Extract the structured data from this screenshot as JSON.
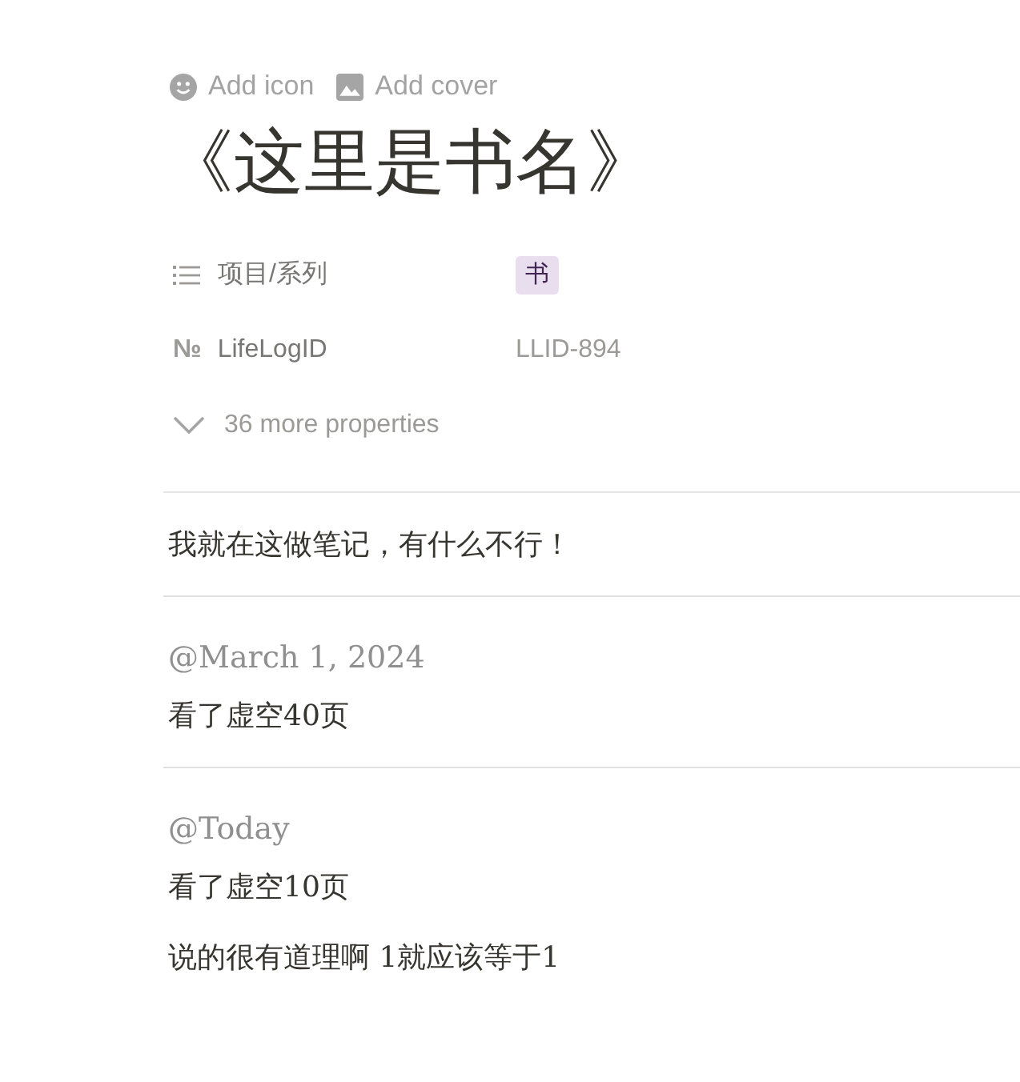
{
  "header_actions": [
    {
      "kind": "icon",
      "label": "Add icon"
    },
    {
      "kind": "cover",
      "label": "Add cover"
    }
  ],
  "title": "《这里是书名》",
  "properties": [
    {
      "kind": "list",
      "name": "项目/系列",
      "tag": "书"
    },
    {
      "kind": "number",
      "icon": "№",
      "name": "LifeLogID",
      "value": "LLID-894"
    }
  ],
  "more_properties": "36 more properties",
  "blocks": [
    {
      "kind": "text",
      "text": "我就在这做笔记，有什么不行！"
    },
    {
      "kind": "divider"
    },
    {
      "kind": "mention",
      "text": "@March 1, 2024"
    },
    {
      "kind": "text",
      "text": "看了虚空40页"
    },
    {
      "kind": "divider"
    },
    {
      "kind": "mention",
      "text": "@Today"
    },
    {
      "kind": "text",
      "text": "看了虚空10页"
    },
    {
      "kind": "text",
      "text": "说的很有道理啊 1就应该等于1"
    }
  ]
}
